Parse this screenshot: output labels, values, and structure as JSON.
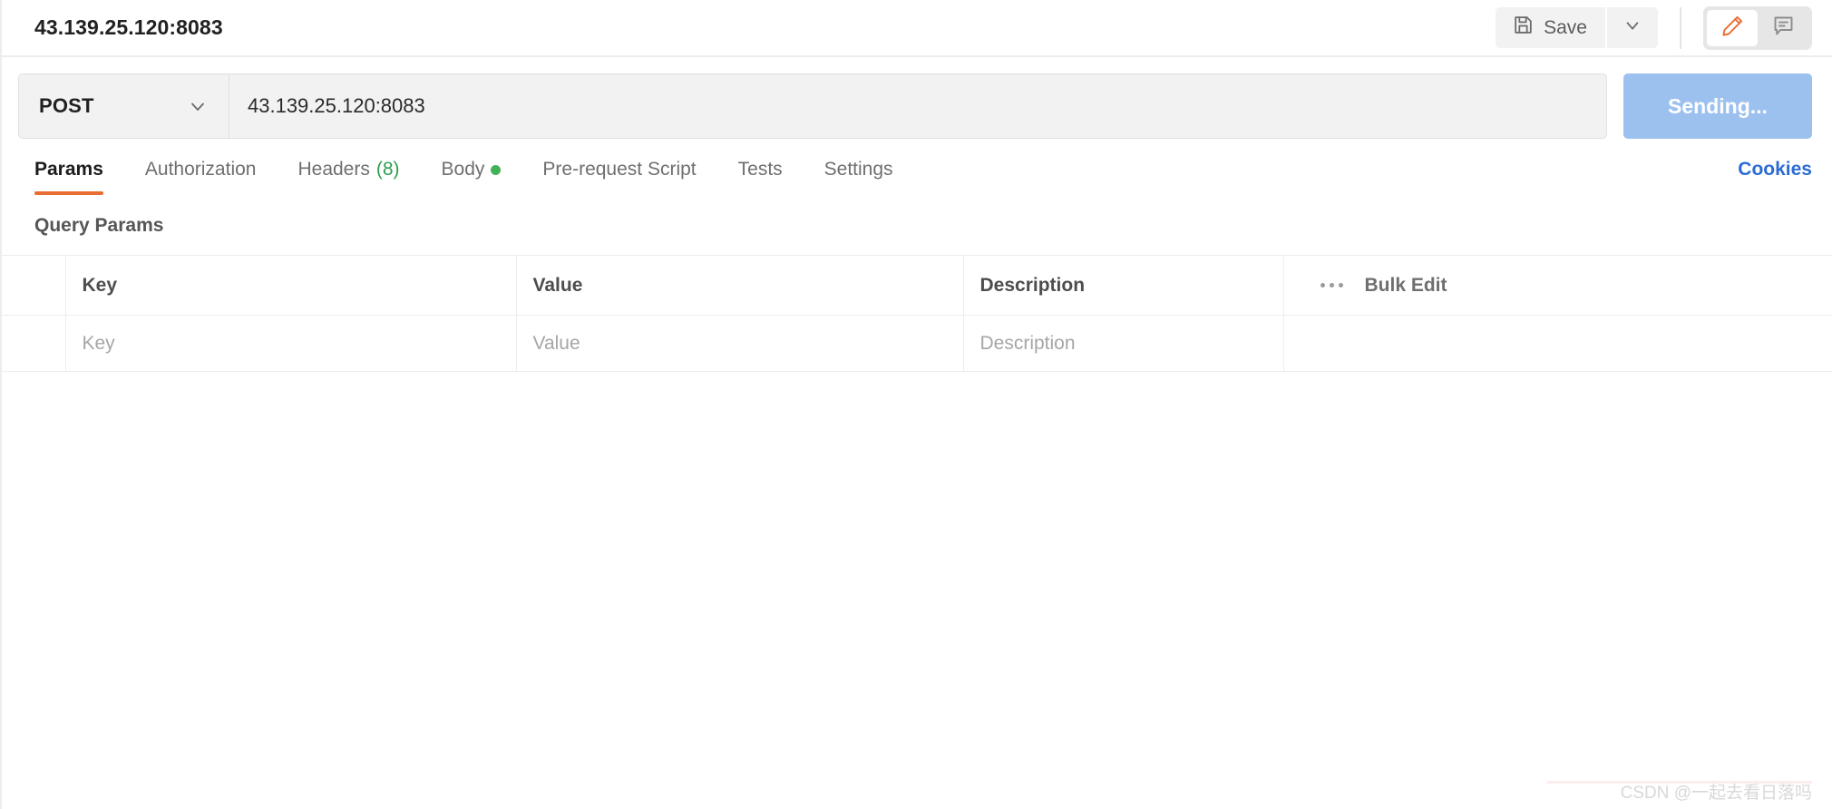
{
  "request": {
    "title": "43.139.25.120:8083",
    "method": "POST",
    "url": "43.139.25.120:8083",
    "send_label": "Sending...",
    "send_state": "sending",
    "send_color": "#9dc1ef"
  },
  "toolbar": {
    "save_label": "Save",
    "save_icon": "floppy-disk-icon",
    "save_caret_icon": "chevron-down-icon",
    "edit_icon": "pencil-icon",
    "comment_icon": "comment-icon",
    "edit_active": true,
    "accent_color": "#ea6c33"
  },
  "tabs": {
    "items": [
      {
        "label": "Params",
        "active": true,
        "count": "",
        "dot": false
      },
      {
        "label": "Authorization",
        "active": false,
        "count": "",
        "dot": false
      },
      {
        "label": "Headers",
        "active": false,
        "count": "(8)",
        "dot": false
      },
      {
        "label": "Body",
        "active": false,
        "count": "",
        "dot": true
      },
      {
        "label": "Pre-request Script",
        "active": false,
        "count": "",
        "dot": false
      },
      {
        "label": "Tests",
        "active": false,
        "count": "",
        "dot": false
      },
      {
        "label": "Settings",
        "active": false,
        "count": "",
        "dot": false
      }
    ],
    "cookies_label": "Cookies",
    "cookies_color": "#2b6cd4",
    "count_color": "#2f9e51",
    "dot_color": "#43b257"
  },
  "params": {
    "section_title": "Query Params",
    "columns": [
      "",
      "Key",
      "Value",
      "Description"
    ],
    "bulk_edit_label": "Bulk Edit",
    "more_icon": "ellipsis-icon",
    "rows": [
      {
        "checked": false,
        "key_placeholder": "Key",
        "value_placeholder": "Value",
        "description_placeholder": "Description",
        "key": "",
        "value": "",
        "description": ""
      }
    ]
  },
  "watermark": {
    "text": "CSDN @一起去看日落吗"
  }
}
